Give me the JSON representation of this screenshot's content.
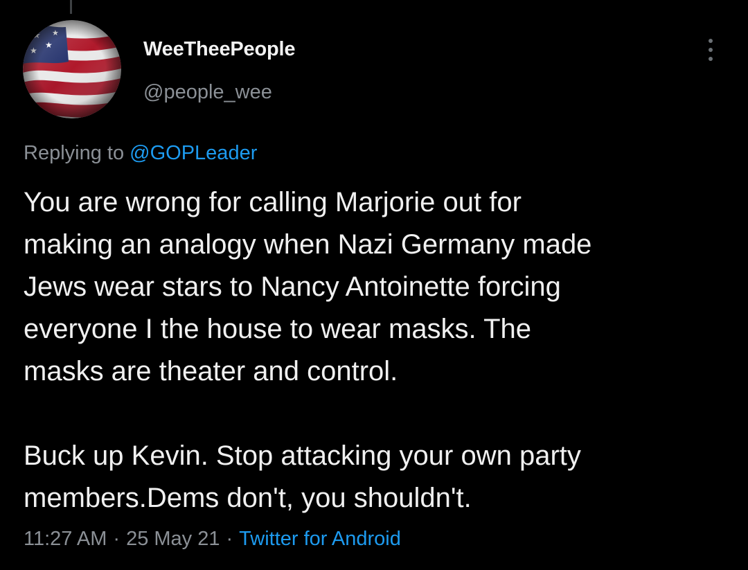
{
  "tweet": {
    "author": {
      "display_name": "WeeTheePeople",
      "handle": "@people_wee",
      "avatar_icon": "american-flag-icon"
    },
    "reply": {
      "prefix": "Replying to ",
      "target": "@GOPLeader"
    },
    "body": [
      "You are wrong for calling Marjorie out for\nmaking an analogy when Nazi Germany made\nJews wear stars to Nancy Antoinette forcing\neveryone I the house to wear masks. The\nmasks are theater and control.",
      "Buck up Kevin. Stop attacking your own party\nmembers.Dems don't, you shouldn't."
    ],
    "time": "11:27 AM",
    "date": "25 May 21",
    "separator": "·",
    "source": "Twitter for Android"
  },
  "colors": {
    "background": "#000000",
    "text": "#f0f0f0",
    "secondary_text": "#8b9096",
    "link": "#1d9bf0"
  },
  "icons": {
    "more": "more-vertical-icon"
  }
}
